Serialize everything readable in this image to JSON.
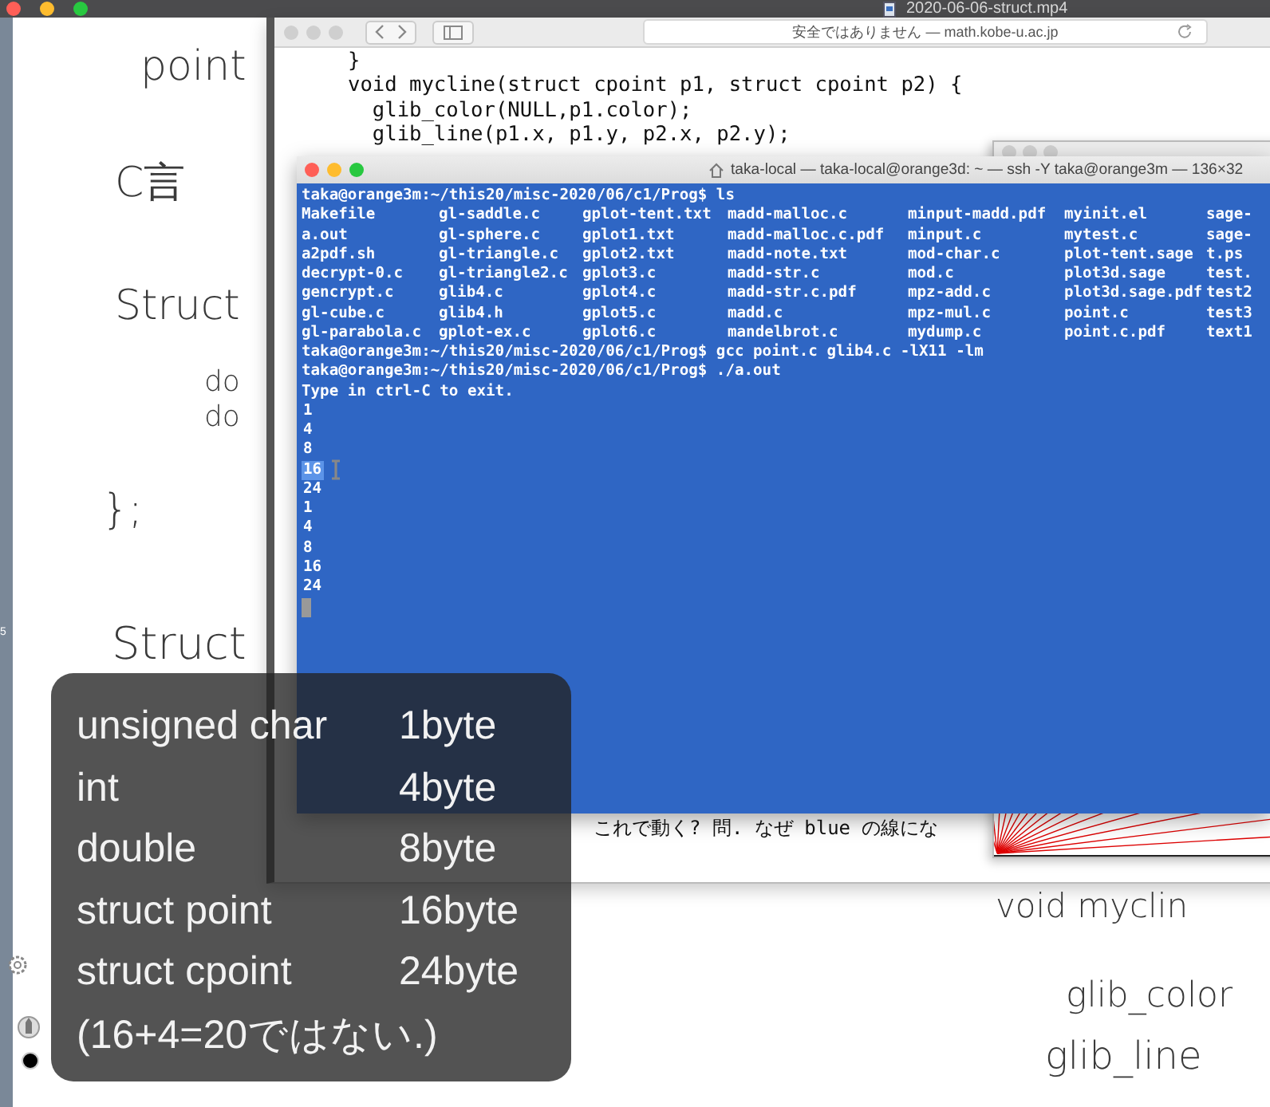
{
  "player_bar": {
    "title": "2020-06-06-struct.mp4"
  },
  "side_strip": {
    "label": "5"
  },
  "whiteboard": {
    "notes_left": [
      "point",
      "C言",
      "Struct",
      "do",
      "do",
      "};",
      "Struct"
    ],
    "notes_right": [
      "void myclin",
      "glib_color",
      "glib_line"
    ]
  },
  "browser": {
    "address": "安全ではありません — math.kobe-u.ac.jp",
    "code_top": [
      "}",
      "void mycline(struct cpoint p1, struct cpoint p2) {",
      "  glib_color(NULL,p1.color);",
      "  glib_line(p1.x, p1.y, p2.x, p2.y);"
    ],
    "code_bottom": [
      "これで動く? 問. なぜ blue の線にな"
    ]
  },
  "terminal": {
    "title": "taka-local — taka-local@orange3d: ~ — ssh -Y taka@orange3m — 136×32",
    "lines_before": [
      "taka@orange3m:~/this20/misc-2020/06/c1/Prog$ ls"
    ],
    "ls_rows": [
      [
        "Makefile",
        "gl-saddle.c",
        "gplot-tent.txt",
        "madd-malloc.c",
        "minput-madd.pdf",
        "myinit.el",
        "sage-"
      ],
      [
        "a.out",
        "gl-sphere.c",
        "gplot1.txt",
        "madd-malloc.c.pdf",
        "minput.c",
        "mytest.c",
        "sage-"
      ],
      [
        "a2pdf.sh",
        "gl-triangle.c",
        "gplot2.txt",
        "madd-note.txt",
        "mod-char.c",
        "plot-tent.sage",
        "t.ps"
      ],
      [
        "decrypt-0.c",
        "gl-triangle2.c",
        "gplot3.c",
        "madd-str.c",
        "mod.c",
        "plot3d.sage",
        "test."
      ],
      [
        "gencrypt.c",
        "glib4.c",
        "gplot4.c",
        "madd-str.c.pdf",
        "mpz-add.c",
        "plot3d.sage.pdf",
        "test2"
      ],
      [
        "gl-cube.c",
        "glib4.h",
        "gplot5.c",
        "madd.c",
        "mpz-mul.c",
        "point.c",
        "test3"
      ],
      [
        "gl-parabola.c",
        "gplot-ex.c",
        "gplot6.c",
        "mandelbrot.c",
        "mydump.c",
        "point.c.pdf",
        "text1"
      ]
    ],
    "lines_after": [
      "taka@orange3m:~/this20/misc-2020/06/c1/Prog$ gcc point.c glib4.c -lX11 -lm",
      "taka@orange3m:~/this20/misc-2020/06/c1/Prog$ ./a.out",
      "Type in ctrl-C to exit."
    ],
    "output": [
      {
        "text": "1",
        "selected": false
      },
      {
        "text": "4",
        "selected": false
      },
      {
        "text": "8",
        "selected": false
      },
      {
        "text": "16",
        "selected": true
      },
      {
        "text": "24",
        "selected": false
      },
      {
        "text": "1",
        "selected": false
      },
      {
        "text": "4",
        "selected": false
      },
      {
        "text": "8",
        "selected": false
      },
      {
        "text": "16",
        "selected": false
      },
      {
        "text": "24",
        "selected": false
      }
    ]
  },
  "caption": {
    "rows": [
      {
        "label": "unsigned char",
        "value": "1byte"
      },
      {
        "label": "int",
        "value": "4byte"
      },
      {
        "label": "double",
        "value": "8byte"
      },
      {
        "label": "struct point",
        "value": "16byte"
      },
      {
        "label": "struct cpoint",
        "value": "24byte"
      }
    ],
    "note": "(16+4=20ではない.)"
  }
}
